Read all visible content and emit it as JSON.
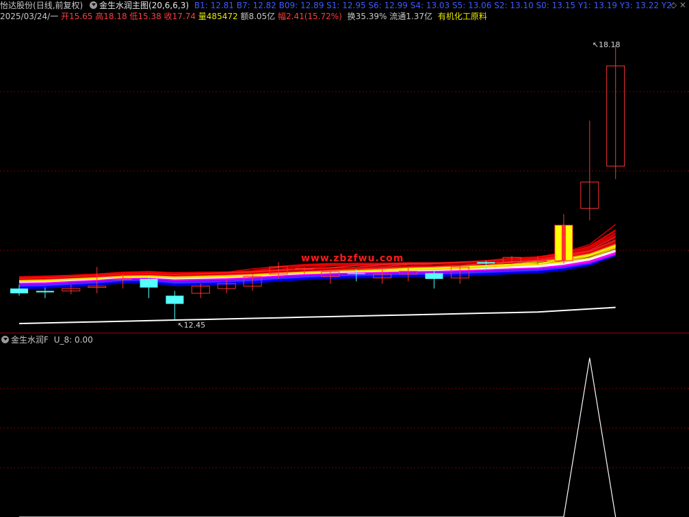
{
  "header": {
    "stock_name": "怡达股份",
    "period": "(日线,前复权)",
    "indicator": "金生水润主图(20,6,6,3)",
    "ma_readout": "B1: 12.81  B7: 12.82  B09: 12.89  S1: 12.95  S6: 12.99  S4: 13.03  S5: 13.06  S2: 13.10  S0: 13.15  Y1: 13.19  Y3: 13.22  Y2:",
    "close_glyph": "◇ ×",
    "date": "2025/03/24/一",
    "open": "开15.65",
    "high": "高18.18",
    "low": "低15.38",
    "close": "收17.74",
    "volume": "量485472",
    "amount": "额8.05亿",
    "change": "幅2.41(15.72%)",
    "turnover": "换35.39%",
    "float": "流通1.37亿",
    "sector": "有机化工原料"
  },
  "watermark": "www.zbzfwu.com",
  "subchart": {
    "title": "金生水润F",
    "readout": "U_8: 0.00"
  },
  "colors": {
    "up": "#ff3232",
    "down": "#54ffff",
    "grid": "#7a0000",
    "divider": "#b00000"
  },
  "chart_data": [
    {
      "type": "candlestick",
      "title": "",
      "annotations": [
        {
          "label": "18.18",
          "x": 22,
          "y": 18.18
        },
        {
          "label": "12.45",
          "x": 6,
          "y": 12.45
        }
      ],
      "ylim": [
        12.3,
        18.6
      ],
      "candles": [
        {
          "o": 13.1,
          "h": 13.18,
          "l": 12.95,
          "c": 13.0
        },
        {
          "o": 13.05,
          "h": 13.12,
          "l": 12.9,
          "c": 13.02
        },
        {
          "o": 13.05,
          "h": 13.18,
          "l": 12.98,
          "c": 13.1
        },
        {
          "o": 13.12,
          "h": 13.55,
          "l": 13.0,
          "c": 13.15
        },
        {
          "o": 13.3,
          "h": 13.4,
          "l": 13.1,
          "c": 13.3
        },
        {
          "o": 13.3,
          "h": 13.32,
          "l": 12.9,
          "c": 13.12
        },
        {
          "o": 12.95,
          "h": 13.05,
          "l": 12.45,
          "c": 12.78
        },
        {
          "o": 13.0,
          "h": 13.2,
          "l": 12.9,
          "c": 13.15
        },
        {
          "o": 13.1,
          "h": 13.3,
          "l": 13.0,
          "c": 13.2
        },
        {
          "o": 13.15,
          "h": 13.4,
          "l": 13.05,
          "c": 13.35
        },
        {
          "o": 13.4,
          "h": 13.65,
          "l": 13.3,
          "c": 13.55
        },
        {
          "o": 13.5,
          "h": 13.55,
          "l": 13.4,
          "c": 13.52
        },
        {
          "o": 13.35,
          "h": 13.5,
          "l": 13.2,
          "c": 13.45
        },
        {
          "o": 13.42,
          "h": 13.5,
          "l": 13.25,
          "c": 13.4
        },
        {
          "o": 13.32,
          "h": 13.5,
          "l": 13.2,
          "c": 13.4
        },
        {
          "o": 13.4,
          "h": 13.55,
          "l": 13.25,
          "c": 13.46
        },
        {
          "o": 13.42,
          "h": 13.48,
          "l": 13.1,
          "c": 13.3
        },
        {
          "o": 13.32,
          "h": 13.58,
          "l": 13.2,
          "c": 13.55
        },
        {
          "o": 13.65,
          "h": 13.68,
          "l": 13.5,
          "c": 13.62
        },
        {
          "o": 13.65,
          "h": 13.78,
          "l": 13.6,
          "c": 13.75
        },
        {
          "o": 13.67,
          "h": 13.78,
          "l": 13.6,
          "c": 13.68
        },
        {
          "o": 13.68,
          "h": 14.65,
          "l": 13.62,
          "c": 14.42
        },
        {
          "o": 14.77,
          "h": 16.6,
          "l": 14.52,
          "c": 15.32
        },
        {
          "o": 15.65,
          "h": 18.18,
          "l": 15.38,
          "c": 17.74
        }
      ]
    },
    {
      "type": "line",
      "title": "",
      "series": [
        {
          "values": [
            0,
            0,
            0,
            0,
            0,
            0,
            0,
            0,
            0,
            0,
            0,
            0,
            0,
            0,
            0,
            0,
            0,
            0,
            0,
            0,
            0,
            0,
            100,
            0
          ]
        }
      ],
      "ylim": [
        0,
        110
      ]
    }
  ]
}
